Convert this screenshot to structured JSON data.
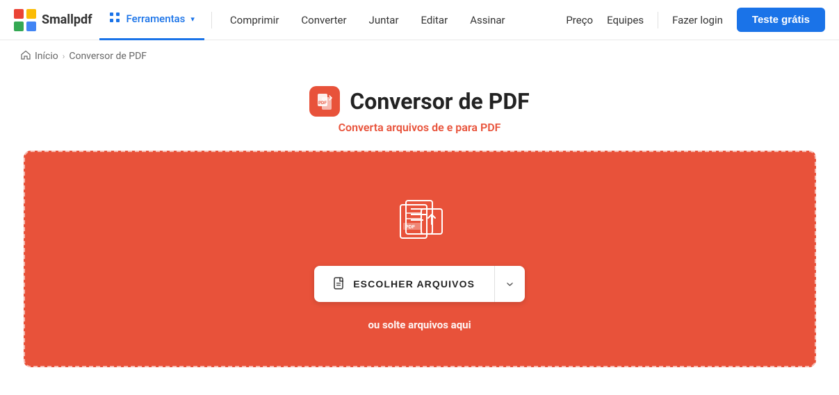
{
  "brand": {
    "name": "Smallpdf"
  },
  "navbar": {
    "ferramentas_label": "Ferramentas",
    "links": [
      {
        "label": "Comprimir",
        "id": "comprimir"
      },
      {
        "label": "Converter",
        "id": "converter"
      },
      {
        "label": "Juntar",
        "id": "juntar"
      },
      {
        "label": "Editar",
        "id": "editar"
      },
      {
        "label": "Assinar",
        "id": "assinar"
      }
    ],
    "right_links": [
      {
        "label": "Preço",
        "id": "preco"
      },
      {
        "label": "Equipes",
        "id": "equipes"
      }
    ],
    "login_label": "Fazer login",
    "trial_label": "Teste grátis"
  },
  "breadcrumb": {
    "home": "Início",
    "current": "Conversor de PDF"
  },
  "page": {
    "title": "Conversor de PDF",
    "subtitle_prefix": "Converta arquivos de e para ",
    "subtitle_highlight": "PDF"
  },
  "upload": {
    "choose_label": "ESCOLHER ARQUIVOS",
    "drop_text": "ou solte arquivos aqui"
  },
  "colors": {
    "brand_red": "#e8523a",
    "brand_blue": "#1a73e8"
  }
}
